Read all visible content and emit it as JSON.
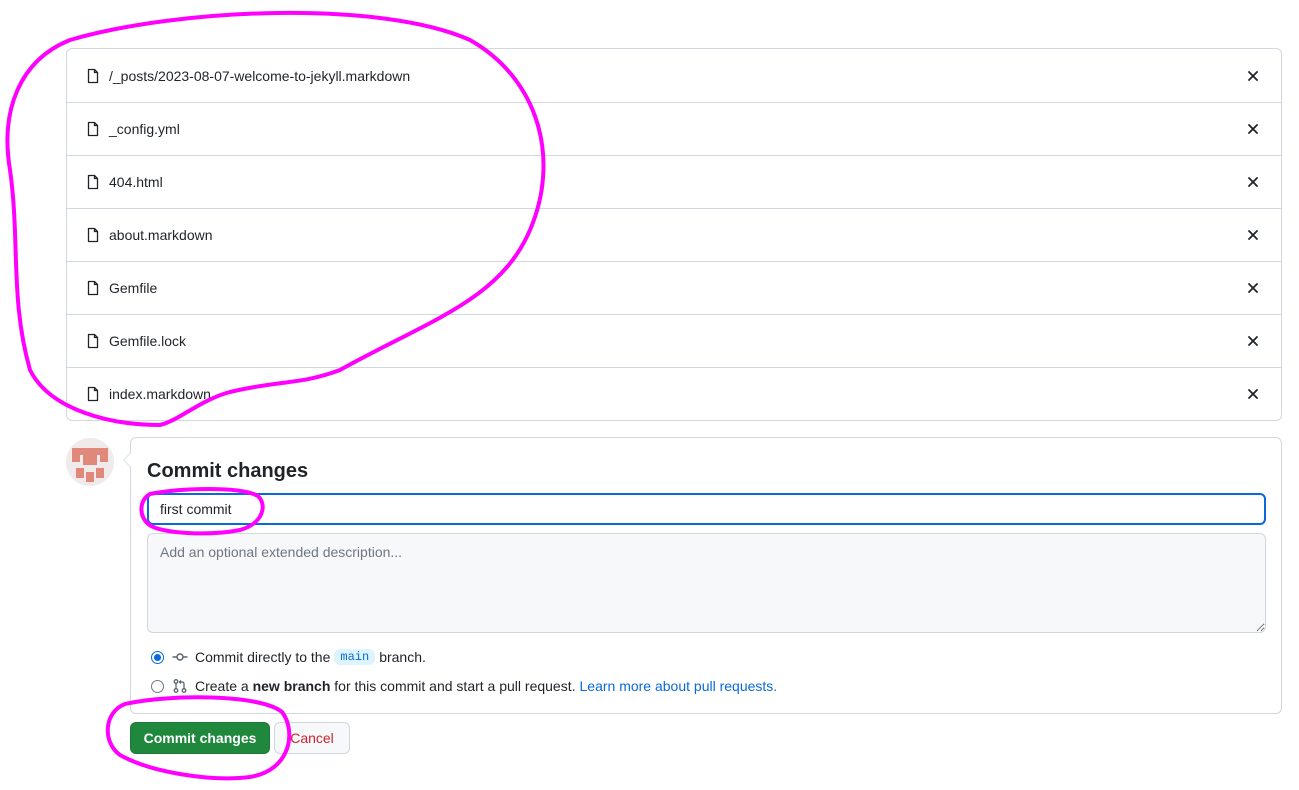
{
  "files": [
    {
      "name": "/_posts/2023-08-07-welcome-to-jekyll.markdown"
    },
    {
      "name": "_config.yml"
    },
    {
      "name": "404.html"
    },
    {
      "name": "about.markdown"
    },
    {
      "name": "Gemfile"
    },
    {
      "name": "Gemfile.lock"
    },
    {
      "name": "index.markdown"
    }
  ],
  "commit": {
    "title": "Commit changes",
    "summary_value": "first commit",
    "description_placeholder": "Add an optional extended description...",
    "option_direct": {
      "prefix": "Commit directly to the",
      "branch": "main",
      "suffix": "branch."
    },
    "option_new_branch": {
      "prefix": "Create a",
      "bold": "new branch",
      "suffix": "for this commit and start a pull request.",
      "link": "Learn more about pull requests."
    }
  },
  "buttons": {
    "commit_label": "Commit changes",
    "cancel_label": "Cancel"
  },
  "colors": {
    "annotation": "#ff00ff",
    "primary_green": "#1f883d",
    "accent_blue": "#0969da",
    "danger_red": "#cf222e"
  },
  "icons": {
    "file": "file-icon",
    "remove": "close-icon",
    "commit": "git-commit-icon",
    "pull_request": "git-pull-request-icon"
  }
}
